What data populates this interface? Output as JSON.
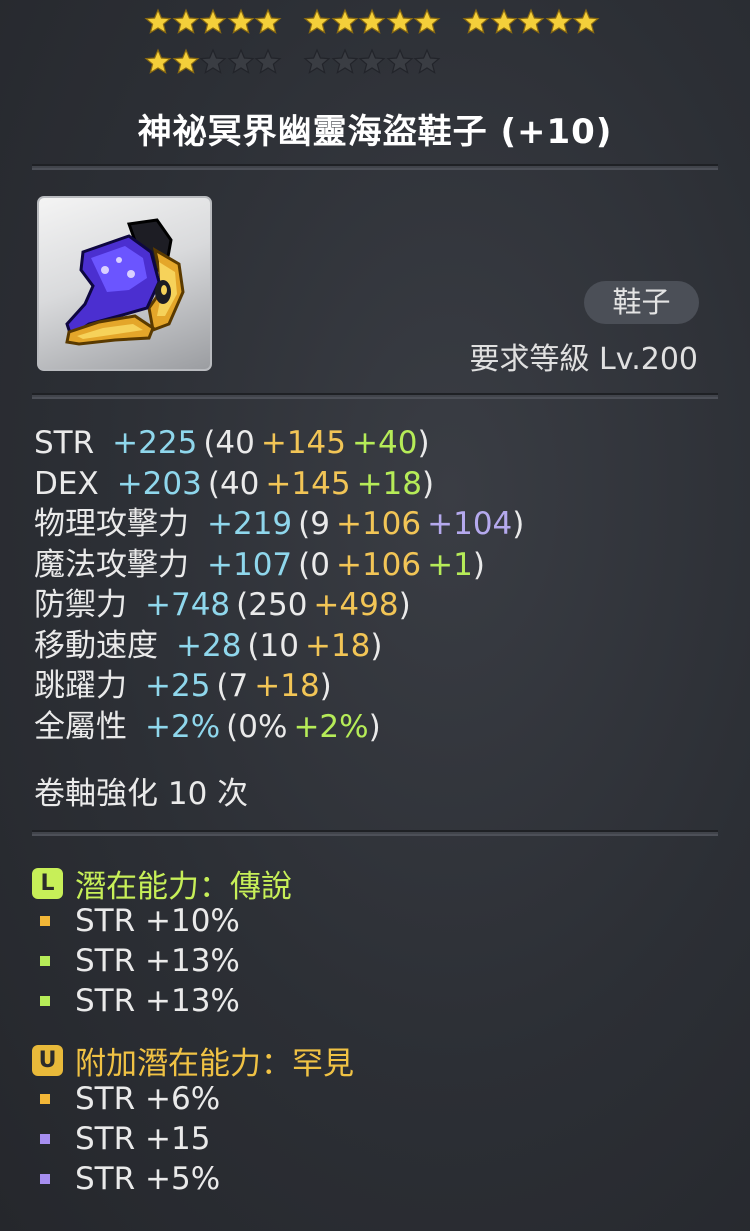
{
  "stars": {
    "total": 25,
    "filled": 17,
    "colors": {
      "filled": "#f4cf3a",
      "empty": "#3a3d43"
    }
  },
  "item": {
    "title": "神祕冥界幽靈海盜鞋子 (+10)",
    "type_badge": "鞋子",
    "required_level": "要求等級 Lv.200",
    "icon": "shoe-icon"
  },
  "stats": [
    {
      "name": "STR",
      "total": "+225",
      "base": "(40",
      "parts": [
        {
          "text": "+145",
          "color": "gold"
        },
        {
          "text": "+40",
          "color": "green"
        }
      ],
      "close": ")"
    },
    {
      "name": "DEX",
      "total": "+203",
      "base": "(40",
      "parts": [
        {
          "text": "+145",
          "color": "gold"
        },
        {
          "text": "+18",
          "color": "green"
        }
      ],
      "close": ")"
    },
    {
      "name": "物理攻擊力",
      "total": "+219",
      "base": "(9",
      "parts": [
        {
          "text": "+106",
          "color": "gold"
        },
        {
          "text": "+104",
          "color": "purple"
        }
      ],
      "close": ")"
    },
    {
      "name": "魔法攻擊力",
      "total": "+107",
      "base": "(0",
      "parts": [
        {
          "text": "+106",
          "color": "gold"
        },
        {
          "text": "+1",
          "color": "green"
        }
      ],
      "close": ")"
    },
    {
      "name": "防禦力",
      "total": "+748",
      "base": "(250",
      "parts": [
        {
          "text": "+498",
          "color": "gold"
        }
      ],
      "close": ")"
    },
    {
      "name": "移動速度",
      "total": "+28",
      "base": "(10",
      "parts": [
        {
          "text": "+18",
          "color": "gold"
        }
      ],
      "close": ")"
    },
    {
      "name": "跳躍力",
      "total": "+25",
      "base": "(7",
      "parts": [
        {
          "text": "+18",
          "color": "gold"
        }
      ],
      "close": ")"
    },
    {
      "name": "全屬性",
      "total": "+2%",
      "base": "(0%",
      "parts": [
        {
          "text": "+2%",
          "color": "green"
        }
      ],
      "close": ")"
    }
  ],
  "scroll": "卷軸強化 10 次",
  "potential": {
    "tier_letter": "L",
    "label": "潛在能力：傳說",
    "lines": [
      {
        "text": "STR +10%",
        "bullet": "gold"
      },
      {
        "text": "STR +13%",
        "bullet": "green"
      },
      {
        "text": "STR +13%",
        "bullet": "green"
      }
    ]
  },
  "additional_potential": {
    "tier_letter": "U",
    "label": "附加潛在能力：罕見",
    "lines": [
      {
        "text": "STR +6%",
        "bullet": "gold"
      },
      {
        "text": "STR +15",
        "bullet": "purple"
      },
      {
        "text": "STR +5%",
        "bullet": "purple"
      }
    ]
  }
}
